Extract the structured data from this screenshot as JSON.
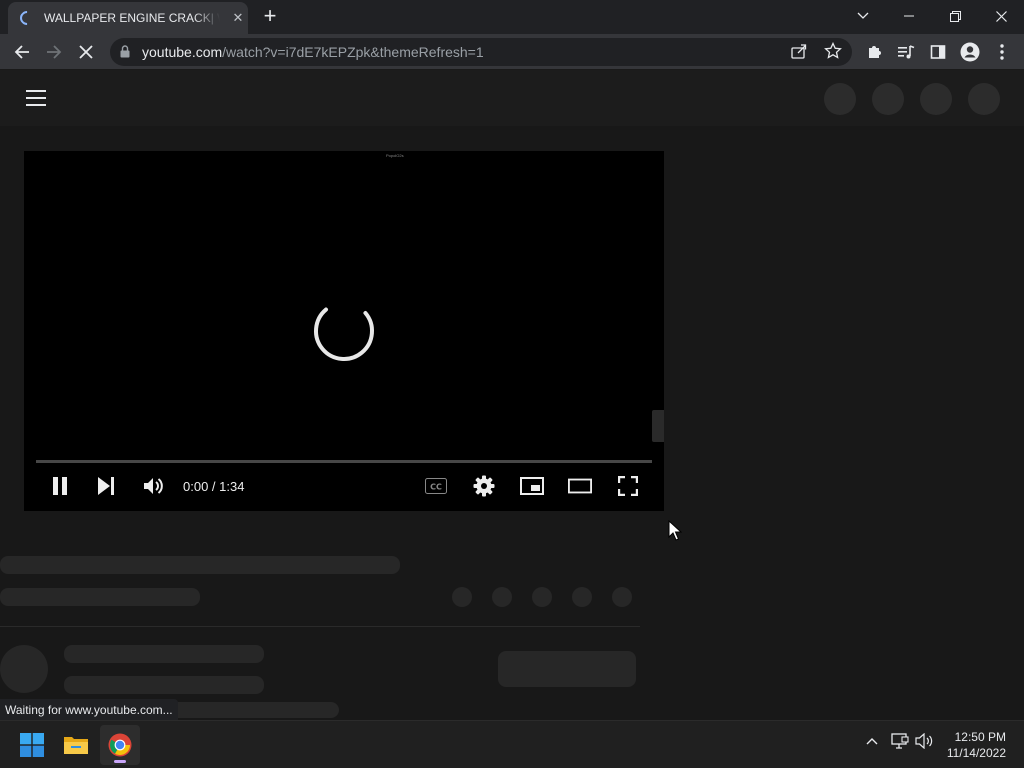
{
  "browser": {
    "tab": {
      "title": "WALLPAPER ENGINE CRACK| WALLPAPER ENGINE FREE DOWNLOAD",
      "close_symbol": "✕"
    },
    "new_tab_symbol": "+",
    "window_controls": {
      "tab_search_icon": "chevron-down-icon",
      "minimize_icon": "minimize-icon",
      "restore_icon": "restore-icon",
      "close_icon": "close-icon"
    },
    "address_bar": {
      "host": "youtube.com",
      "path": "/watch?v=i7dE7kEPZpk&themeRefresh=1"
    },
    "status_text": "Waiting for www.youtube.com..."
  },
  "player": {
    "time_display": "0:00 / 1:34",
    "tiny_label": "PopolO2s",
    "progress_fraction": 0.0,
    "accent_color": "#ff0000"
  },
  "taskbar": {
    "apps": [
      "windows-start",
      "file-explorer",
      "google-chrome"
    ],
    "active_app": "google-chrome",
    "clock": {
      "time": "12:50 PM",
      "date": "11/14/2022"
    }
  }
}
